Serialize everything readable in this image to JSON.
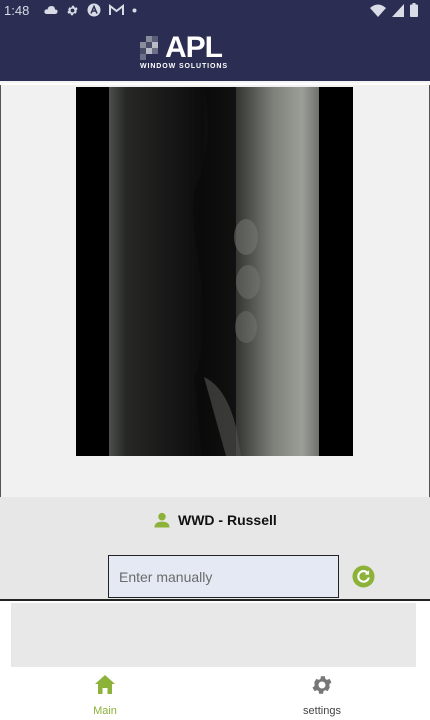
{
  "status_bar": {
    "time": "1:48",
    "left_icons": [
      "cloud-icon",
      "gear-icon",
      "circle-a-icon",
      "gmail-icon",
      "dot-icon"
    ],
    "right_icons": [
      "wifi-icon",
      "signal-icon",
      "battery-icon"
    ]
  },
  "header": {
    "logo_text": "APL",
    "logo_subtext": "WINDOW SOLUTIONS",
    "background_color": "#2b2e52"
  },
  "camera": {
    "preview": "camera-feed"
  },
  "user": {
    "name": "WWD - Russell",
    "icon": "person-icon",
    "icon_color": "#8cb23a"
  },
  "manual_entry": {
    "placeholder": "Enter manually",
    "value": ""
  },
  "refresh": {
    "icon": "refresh-icon",
    "color": "#8cb23a"
  },
  "nav": {
    "items": [
      {
        "label": "Main",
        "icon": "home-icon",
        "active": true,
        "color": "#8cb23a"
      },
      {
        "label": "settings",
        "icon": "gear-icon",
        "active": false,
        "color": "#777777"
      }
    ]
  }
}
